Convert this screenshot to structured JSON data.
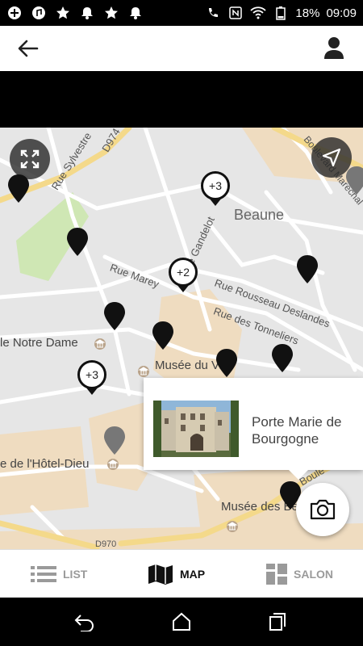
{
  "status_bar": {
    "battery": "18%",
    "time": "09:09",
    "left_icons": [
      "add-icon",
      "music-icon",
      "star-icon",
      "bell-icon",
      "star-icon",
      "bell-icon"
    ],
    "right_icons": [
      "phone-icon",
      "nfc-icon",
      "wifi-icon",
      "battery-icon"
    ]
  },
  "app_bar": {
    "back_icon": "arrow-left-icon",
    "user_icon": "user-icon"
  },
  "map": {
    "roads": [
      "D974",
      "Rue Sylvestre",
      "Rue Gandelot",
      "Rue Marey",
      "Rue Rousseau Deslandes",
      "Rue des Tonneliers",
      "Boulevard Maréchal",
      "Boule",
      "D970"
    ],
    "place": "Beaune",
    "pois": [
      "le Notre Dame",
      "Musée du Vin de Bourgogne",
      "e de l'Hôtel-Dieu",
      "Musée des Beaux-Arts"
    ],
    "clusters": [
      "+3",
      "+2",
      "+3"
    ],
    "accent": "#111111",
    "road_major": "#f4d98a"
  },
  "popup": {
    "title": "Porte Marie de Bourgogne"
  },
  "tabs": [
    {
      "label": "LIST",
      "icon": "list-icon"
    },
    {
      "label": "MAP",
      "icon": "map-icon",
      "active": true
    },
    {
      "label": "SALON",
      "icon": "salon-icon"
    }
  ],
  "nav": {
    "icons": [
      "back-icon",
      "home-icon",
      "recents-icon"
    ]
  }
}
